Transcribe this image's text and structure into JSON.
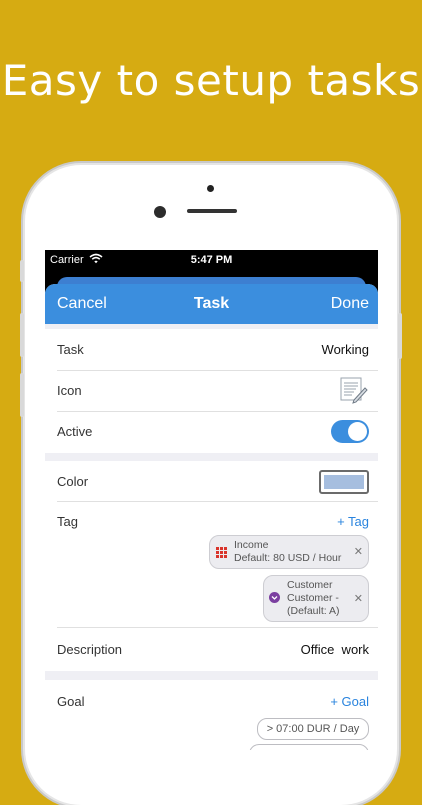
{
  "headline": "Easy to setup tasks",
  "status_bar": {
    "carrier": "Carrier",
    "time": "5:47 PM"
  },
  "nav": {
    "cancel_label": "Cancel",
    "title": "Task",
    "done_label": "Done"
  },
  "task_row": {
    "label": "Task",
    "value": "Working"
  },
  "icon_row": {
    "label": "Icon",
    "icon": "document-pencil-icon"
  },
  "active_row": {
    "label": "Active",
    "on": true
  },
  "color_row": {
    "label": "Color",
    "color": "#a6bedf"
  },
  "tag_row": {
    "label": "Tag",
    "add_label": "+ Tag",
    "chips": [
      {
        "line1": "Income",
        "line2": "Default: 80 USD / Hour",
        "icon": "grid-icon",
        "icon_color": "#d9342b"
      },
      {
        "line1": "Customer",
        "line2": "Customer -",
        "line3": "(Default: A)",
        "icon": "chevron-circle-icon",
        "icon_color": "#7b3fa0"
      }
    ]
  },
  "description_row": {
    "label": "Description",
    "value": "Office  work"
  },
  "goal_row": {
    "label": "Goal",
    "add_label": "+ Goal",
    "chips": [
      "> 07:00 DUR / Day"
    ]
  },
  "colors": {
    "background": "#d6ab12",
    "nav_blue": "#3b8ede",
    "link_blue": "#2a84de"
  }
}
